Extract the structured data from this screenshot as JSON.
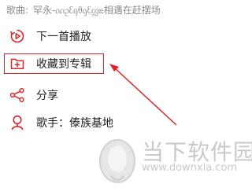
{
  "song_info": {
    "label": "歌曲:",
    "value": "罕永-ᦶᦳᦷᦏᦲᧂᦷᦜᦰ相遇在赶摆场"
  },
  "menu": {
    "items": [
      {
        "label": "下一首播放",
        "icon": "play-next-icon"
      },
      {
        "label": "收藏到专辑",
        "icon": "add-to-folder-icon"
      },
      {
        "label": "分享",
        "icon": "share-icon"
      },
      {
        "label": "歌手：傣族基地",
        "icon": "singer-icon"
      }
    ]
  },
  "watermark": {
    "text": "当下软件园",
    "url": "www.downxia.com"
  },
  "colors": {
    "accent_red": "#d9262b",
    "text": "#222222",
    "muted": "#8c8c8c"
  }
}
